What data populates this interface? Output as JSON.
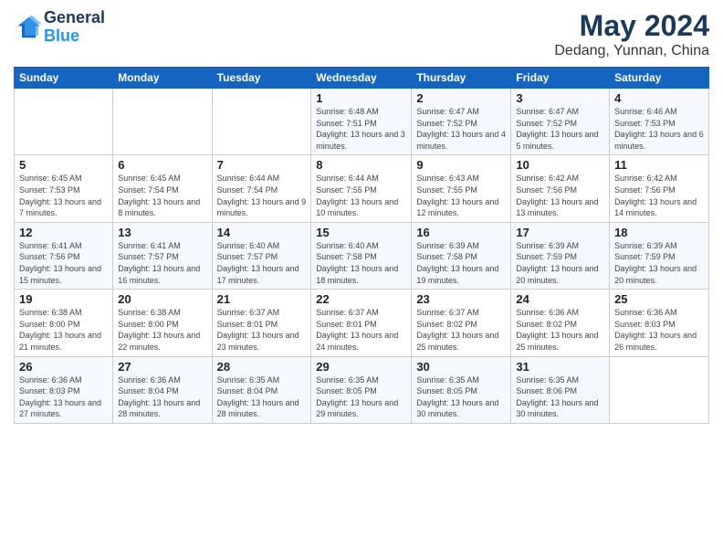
{
  "header": {
    "logo_line1": "General",
    "logo_line2": "Blue",
    "main_title": "May 2024",
    "sub_title": "Dedang, Yunnan, China"
  },
  "days_of_week": [
    "Sunday",
    "Monday",
    "Tuesday",
    "Wednesday",
    "Thursday",
    "Friday",
    "Saturday"
  ],
  "weeks": [
    [
      {
        "day": "",
        "info": ""
      },
      {
        "day": "",
        "info": ""
      },
      {
        "day": "",
        "info": ""
      },
      {
        "day": "1",
        "info": "Sunrise: 6:48 AM\nSunset: 7:51 PM\nDaylight: 13 hours and 3 minutes."
      },
      {
        "day": "2",
        "info": "Sunrise: 6:47 AM\nSunset: 7:52 PM\nDaylight: 13 hours and 4 minutes."
      },
      {
        "day": "3",
        "info": "Sunrise: 6:47 AM\nSunset: 7:52 PM\nDaylight: 13 hours and 5 minutes."
      },
      {
        "day": "4",
        "info": "Sunrise: 6:46 AM\nSunset: 7:53 PM\nDaylight: 13 hours and 6 minutes."
      }
    ],
    [
      {
        "day": "5",
        "info": "Sunrise: 6:45 AM\nSunset: 7:53 PM\nDaylight: 13 hours and 7 minutes."
      },
      {
        "day": "6",
        "info": "Sunrise: 6:45 AM\nSunset: 7:54 PM\nDaylight: 13 hours and 8 minutes."
      },
      {
        "day": "7",
        "info": "Sunrise: 6:44 AM\nSunset: 7:54 PM\nDaylight: 13 hours and 9 minutes."
      },
      {
        "day": "8",
        "info": "Sunrise: 6:44 AM\nSunset: 7:55 PM\nDaylight: 13 hours and 10 minutes."
      },
      {
        "day": "9",
        "info": "Sunrise: 6:43 AM\nSunset: 7:55 PM\nDaylight: 13 hours and 12 minutes."
      },
      {
        "day": "10",
        "info": "Sunrise: 6:42 AM\nSunset: 7:56 PM\nDaylight: 13 hours and 13 minutes."
      },
      {
        "day": "11",
        "info": "Sunrise: 6:42 AM\nSunset: 7:56 PM\nDaylight: 13 hours and 14 minutes."
      }
    ],
    [
      {
        "day": "12",
        "info": "Sunrise: 6:41 AM\nSunset: 7:56 PM\nDaylight: 13 hours and 15 minutes."
      },
      {
        "day": "13",
        "info": "Sunrise: 6:41 AM\nSunset: 7:57 PM\nDaylight: 13 hours and 16 minutes."
      },
      {
        "day": "14",
        "info": "Sunrise: 6:40 AM\nSunset: 7:57 PM\nDaylight: 13 hours and 17 minutes."
      },
      {
        "day": "15",
        "info": "Sunrise: 6:40 AM\nSunset: 7:58 PM\nDaylight: 13 hours and 18 minutes."
      },
      {
        "day": "16",
        "info": "Sunrise: 6:39 AM\nSunset: 7:58 PM\nDaylight: 13 hours and 19 minutes."
      },
      {
        "day": "17",
        "info": "Sunrise: 6:39 AM\nSunset: 7:59 PM\nDaylight: 13 hours and 20 minutes."
      },
      {
        "day": "18",
        "info": "Sunrise: 6:39 AM\nSunset: 7:59 PM\nDaylight: 13 hours and 20 minutes."
      }
    ],
    [
      {
        "day": "19",
        "info": "Sunrise: 6:38 AM\nSunset: 8:00 PM\nDaylight: 13 hours and 21 minutes."
      },
      {
        "day": "20",
        "info": "Sunrise: 6:38 AM\nSunset: 8:00 PM\nDaylight: 13 hours and 22 minutes."
      },
      {
        "day": "21",
        "info": "Sunrise: 6:37 AM\nSunset: 8:01 PM\nDaylight: 13 hours and 23 minutes."
      },
      {
        "day": "22",
        "info": "Sunrise: 6:37 AM\nSunset: 8:01 PM\nDaylight: 13 hours and 24 minutes."
      },
      {
        "day": "23",
        "info": "Sunrise: 6:37 AM\nSunset: 8:02 PM\nDaylight: 13 hours and 25 minutes."
      },
      {
        "day": "24",
        "info": "Sunrise: 6:36 AM\nSunset: 8:02 PM\nDaylight: 13 hours and 25 minutes."
      },
      {
        "day": "25",
        "info": "Sunrise: 6:36 AM\nSunset: 8:03 PM\nDaylight: 13 hours and 26 minutes."
      }
    ],
    [
      {
        "day": "26",
        "info": "Sunrise: 6:36 AM\nSunset: 8:03 PM\nDaylight: 13 hours and 27 minutes."
      },
      {
        "day": "27",
        "info": "Sunrise: 6:36 AM\nSunset: 8:04 PM\nDaylight: 13 hours and 28 minutes."
      },
      {
        "day": "28",
        "info": "Sunrise: 6:35 AM\nSunset: 8:04 PM\nDaylight: 13 hours and 28 minutes."
      },
      {
        "day": "29",
        "info": "Sunrise: 6:35 AM\nSunset: 8:05 PM\nDaylight: 13 hours and 29 minutes."
      },
      {
        "day": "30",
        "info": "Sunrise: 6:35 AM\nSunset: 8:05 PM\nDaylight: 13 hours and 30 minutes."
      },
      {
        "day": "31",
        "info": "Sunrise: 6:35 AM\nSunset: 8:06 PM\nDaylight: 13 hours and 30 minutes."
      },
      {
        "day": "",
        "info": ""
      }
    ]
  ]
}
